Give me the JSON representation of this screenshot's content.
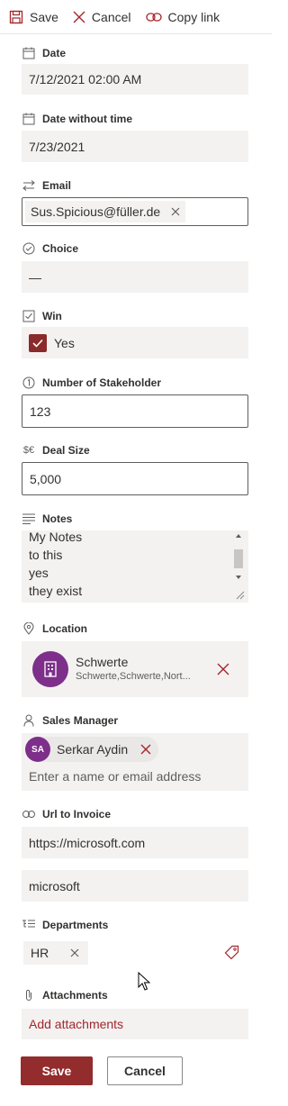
{
  "commandbar": {
    "save_label": "Save",
    "cancel_label": "Cancel",
    "copy_link_label": "Copy link"
  },
  "fields": {
    "date": {
      "label": "Date",
      "value": "7/12/2021 02:00 AM"
    },
    "date_without_time": {
      "label": "Date without time",
      "value": "7/23/2021"
    },
    "email": {
      "label": "Email",
      "value": "Sus.Spicious@füller.de"
    },
    "choice": {
      "label": "Choice",
      "value": "—"
    },
    "win": {
      "label": "Win",
      "value": "Yes",
      "checked": true
    },
    "stakeholders": {
      "label": "Number of Stakeholder",
      "value": "123"
    },
    "deal_size": {
      "label": "Deal Size",
      "value": "5,000"
    },
    "notes": {
      "label": "Notes",
      "lines": [
        "My Notes",
        "to this",
        "yes",
        "they exist"
      ]
    },
    "location": {
      "label": "Location",
      "title": "Schwerte",
      "subtitle": "Schwerte,Schwerte,Nort..."
    },
    "sales_manager": {
      "label": "Sales Manager",
      "initials": "SA",
      "name": "Serkar Aydin",
      "placeholder": "Enter a name or email address"
    },
    "url_to_invoice": {
      "label": "Url to Invoice",
      "url": "https://microsoft.com",
      "description": "microsoft"
    },
    "departments": {
      "label": "Departments",
      "tag": "HR"
    },
    "attachments": {
      "label": "Attachments",
      "add_label": "Add attachments"
    }
  },
  "footer": {
    "save_label": "Save",
    "cancel_label": "Cancel"
  },
  "colors": {
    "accent": "#932c2c",
    "field_bg": "#f3f2f1",
    "persona": "#7d2f8a"
  }
}
